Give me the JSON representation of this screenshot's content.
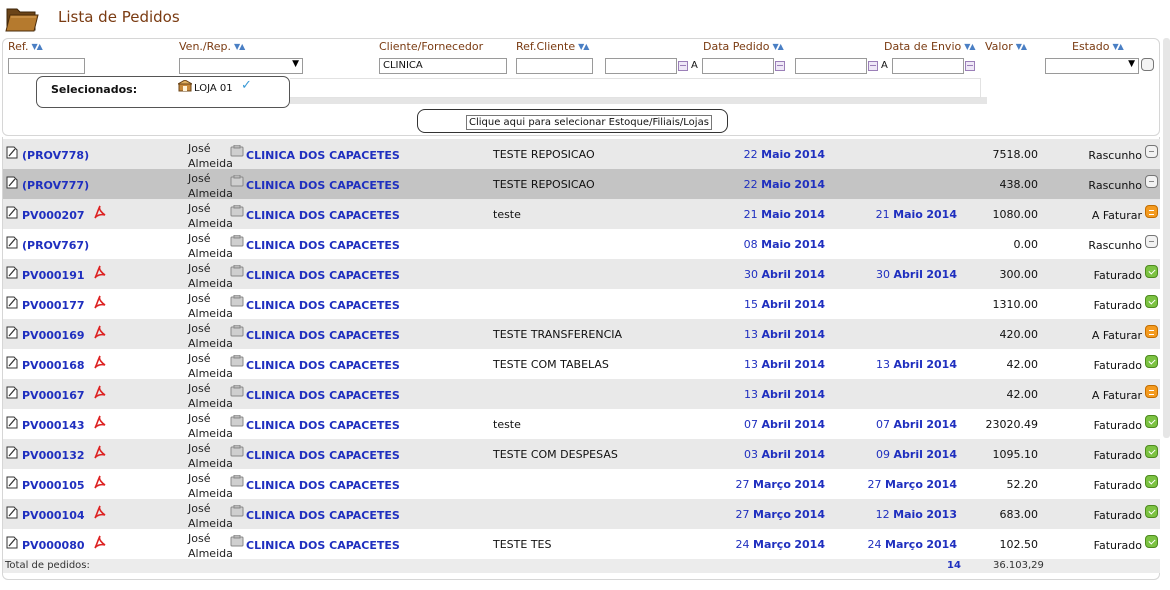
{
  "header": {
    "title": "Lista de Pedidos"
  },
  "columns": {
    "ref": "Ref.",
    "vendor": "Ven./Rep.",
    "client": "Cliente/Fornecedor",
    "client_ref": "Ref.Cliente",
    "order_date": "Data Pedido",
    "ship_date": "Data de Envio",
    "value": "Valor",
    "state": "Estado"
  },
  "filters": {
    "client_value": "CLINICA",
    "range_sep": "A"
  },
  "selection": {
    "label": "Selecionados:",
    "store": "LOJA 01",
    "check": "✓",
    "choose_button": "Clique aqui para selecionar Estoque/Filiais/Lojas"
  },
  "orders": [
    {
      "ref": "(PROV778)",
      "pdf": false,
      "vendor": "José Almeida",
      "client": "CLINICA DOS CAPACETES",
      "client_ref": "TESTE REPOSICAO",
      "order_day": "22",
      "order_month": "Maio",
      "order_year": "2014",
      "ship_day": "",
      "ship_month": "",
      "ship_year": "",
      "value": "7518.00",
      "state": "Rascunho",
      "state_color": "grey"
    },
    {
      "ref": "(PROV777)",
      "pdf": false,
      "vendor": "José Almeida",
      "client": "CLINICA DOS CAPACETES",
      "client_ref": "TESTE REPOSICAO",
      "order_day": "22",
      "order_month": "Maio",
      "order_year": "2014",
      "ship_day": "",
      "ship_month": "",
      "ship_year": "",
      "value": "438.00",
      "state": "Rascunho",
      "state_color": "grey"
    },
    {
      "ref": "PV000207",
      "pdf": true,
      "vendor": "José Almeida",
      "client": "CLINICA DOS CAPACETES",
      "client_ref": "teste",
      "order_day": "21",
      "order_month": "Maio",
      "order_year": "2014",
      "ship_day": "21",
      "ship_month": "Maio",
      "ship_year": "2014",
      "value": "1080.00",
      "state": "A Faturar",
      "state_color": "orange"
    },
    {
      "ref": "(PROV767)",
      "pdf": false,
      "vendor": "José Almeida",
      "client": "CLINICA DOS CAPACETES",
      "client_ref": "",
      "order_day": "08",
      "order_month": "Maio",
      "order_year": "2014",
      "ship_day": "",
      "ship_month": "",
      "ship_year": "",
      "value": "0.00",
      "state": "Rascunho",
      "state_color": "grey"
    },
    {
      "ref": "PV000191",
      "pdf": true,
      "vendor": "José Almeida",
      "client": "CLINICA DOS CAPACETES",
      "client_ref": "",
      "order_day": "30",
      "order_month": "Abril",
      "order_year": "2014",
      "ship_day": "30",
      "ship_month": "Abril",
      "ship_year": "2014",
      "value": "300.00",
      "state": "Faturado",
      "state_color": "green"
    },
    {
      "ref": "PV000177",
      "pdf": true,
      "vendor": "José Almeida",
      "client": "CLINICA DOS CAPACETES",
      "client_ref": "",
      "order_day": "15",
      "order_month": "Abril",
      "order_year": "2014",
      "ship_day": "",
      "ship_month": "",
      "ship_year": "",
      "value": "1310.00",
      "state": "Faturado",
      "state_color": "green"
    },
    {
      "ref": "PV000169",
      "pdf": true,
      "vendor": "José Almeida",
      "client": "CLINICA DOS CAPACETES",
      "client_ref": "TESTE TRANSFERENCIA",
      "order_day": "13",
      "order_month": "Abril",
      "order_year": "2014",
      "ship_day": "",
      "ship_month": "",
      "ship_year": "",
      "value": "420.00",
      "state": "A Faturar",
      "state_color": "orange"
    },
    {
      "ref": "PV000168",
      "pdf": true,
      "vendor": "José Almeida",
      "client": "CLINICA DOS CAPACETES",
      "client_ref": "TESTE COM TABELAS",
      "order_day": "13",
      "order_month": "Abril",
      "order_year": "2014",
      "ship_day": "13",
      "ship_month": "Abril",
      "ship_year": "2014",
      "value": "42.00",
      "state": "Faturado",
      "state_color": "green"
    },
    {
      "ref": "PV000167",
      "pdf": true,
      "vendor": "José Almeida",
      "client": "CLINICA DOS CAPACETES",
      "client_ref": "",
      "order_day": "13",
      "order_month": "Abril",
      "order_year": "2014",
      "ship_day": "",
      "ship_month": "",
      "ship_year": "",
      "value": "42.00",
      "state": "A Faturar",
      "state_color": "orange"
    },
    {
      "ref": "PV000143",
      "pdf": true,
      "vendor": "José Almeida",
      "client": "CLINICA DOS CAPACETES",
      "client_ref": "teste",
      "order_day": "07",
      "order_month": "Abril",
      "order_year": "2014",
      "ship_day": "07",
      "ship_month": "Abril",
      "ship_year": "2014",
      "value": "23020.49",
      "state": "Faturado",
      "state_color": "green"
    },
    {
      "ref": "PV000132",
      "pdf": true,
      "vendor": "José Almeida",
      "client": "CLINICA DOS CAPACETES",
      "client_ref": "TESTE COM DESPESAS",
      "order_day": "03",
      "order_month": "Abril",
      "order_year": "2014",
      "ship_day": "09",
      "ship_month": "Abril",
      "ship_year": "2014",
      "value": "1095.10",
      "state": "Faturado",
      "state_color": "green"
    },
    {
      "ref": "PV000105",
      "pdf": true,
      "vendor": "José Almeida",
      "client": "CLINICA DOS CAPACETES",
      "client_ref": "",
      "order_day": "27",
      "order_month": "Março",
      "order_year": "2014",
      "ship_day": "27",
      "ship_month": "Março",
      "ship_year": "2014",
      "value": "52.20",
      "state": "Faturado",
      "state_color": "green"
    },
    {
      "ref": "PV000104",
      "pdf": true,
      "vendor": "José Almeida",
      "client": "CLINICA DOS CAPACETES",
      "client_ref": "",
      "order_day": "27",
      "order_month": "Março",
      "order_year": "2014",
      "ship_day": "12",
      "ship_month": "Maio",
      "ship_year": "2013",
      "value": "683.00",
      "state": "Faturado",
      "state_color": "green"
    },
    {
      "ref": "PV000080",
      "pdf": true,
      "vendor": "José Almeida",
      "client": "CLINICA DOS CAPACETES",
      "client_ref": "TESTE TES",
      "order_day": "24",
      "order_month": "Março",
      "order_year": "2014",
      "ship_day": "24",
      "ship_month": "Março",
      "ship_year": "2014",
      "value": "102.50",
      "state": "Faturado",
      "state_color": "green"
    }
  ],
  "totals": {
    "label": "Total de pedidos:",
    "count": "14",
    "value": "36.103,29"
  }
}
